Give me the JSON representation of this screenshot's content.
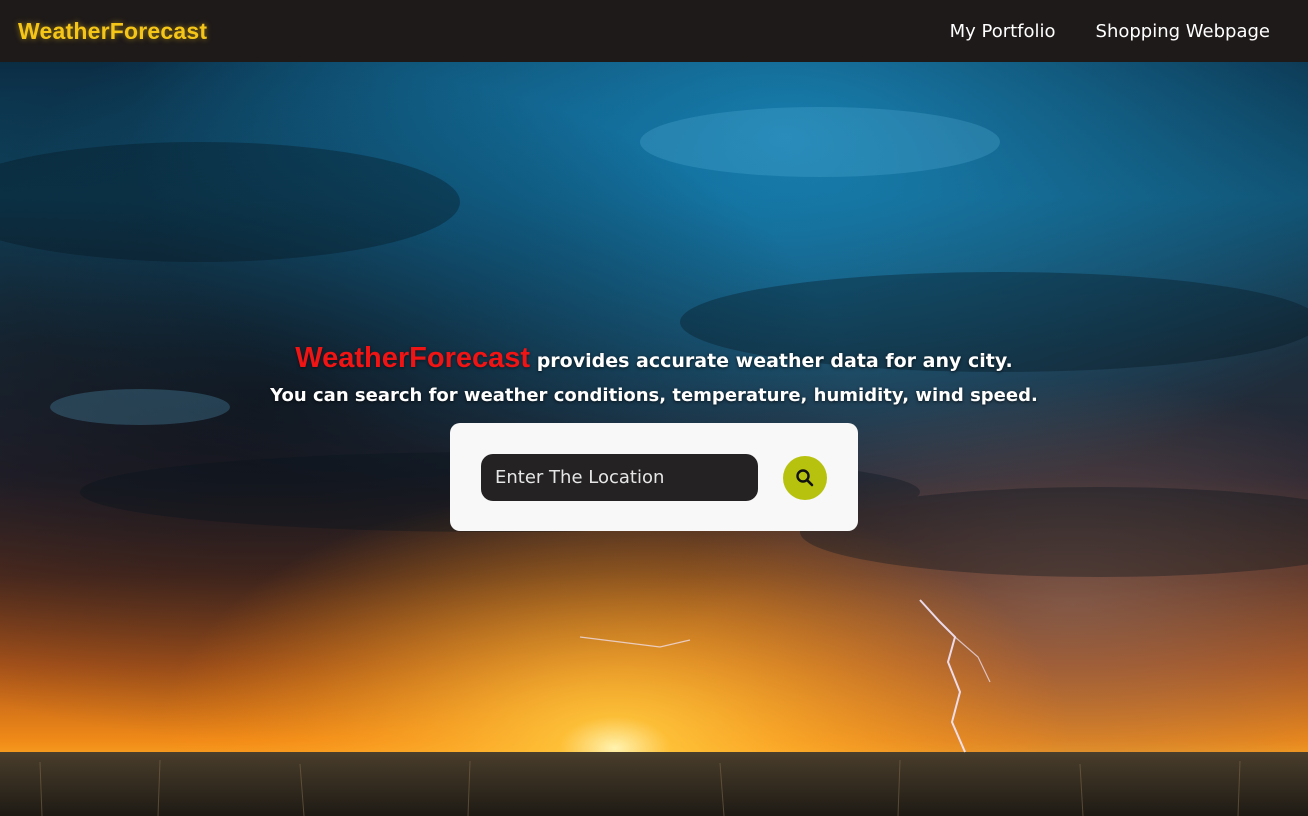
{
  "navbar": {
    "brand": "WeatherForecast",
    "links": [
      {
        "label": "My Portfolio"
      },
      {
        "label": "Shopping Webpage"
      }
    ]
  },
  "hero": {
    "tagline_brand": "WeatherForecast",
    "tagline_text": "provides accurate weather data for any city.",
    "subtitle": "You can search for weather conditions, temperature, humidity, wind speed."
  },
  "search": {
    "placeholder": "Enter The Location",
    "value": "",
    "button_icon": "search-icon"
  },
  "colors": {
    "navbar_bg": "#1e1a19",
    "brand_yellow": "#f5c518",
    "brand_red": "#f01414",
    "search_button": "#b7c20e",
    "input_bg": "#242222"
  }
}
